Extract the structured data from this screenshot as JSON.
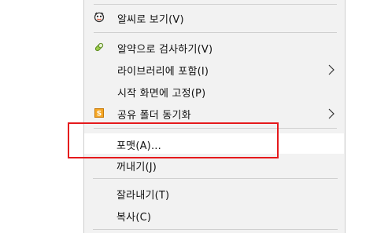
{
  "menu": {
    "items": [
      {
        "label": "알씨로 보기(V)",
        "icon": "alsee-icon",
        "submenu": false
      },
      {
        "label": "알약으로 검사하기(V)",
        "icon": "alyac-icon",
        "submenu": false
      },
      {
        "label": "라이브러리에 포함(I)",
        "icon": "",
        "submenu": true
      },
      {
        "label": "시작 화면에 고정(P)",
        "icon": "",
        "submenu": false
      },
      {
        "label": "공유 폴더 동기화",
        "icon": "sync-folder-icon",
        "submenu": true
      },
      {
        "label": "포맷(A)...",
        "icon": "",
        "submenu": false
      },
      {
        "label": "꺼내기(J)",
        "icon": "",
        "submenu": false
      },
      {
        "label": "잘라내기(T)",
        "icon": "",
        "submenu": false
      },
      {
        "label": "복사(C)",
        "icon": "",
        "submenu": false
      }
    ]
  },
  "colors": {
    "menu_bg": "#f2f2f2",
    "highlight_border": "#e5191c",
    "separator": "#d0d0d0"
  }
}
